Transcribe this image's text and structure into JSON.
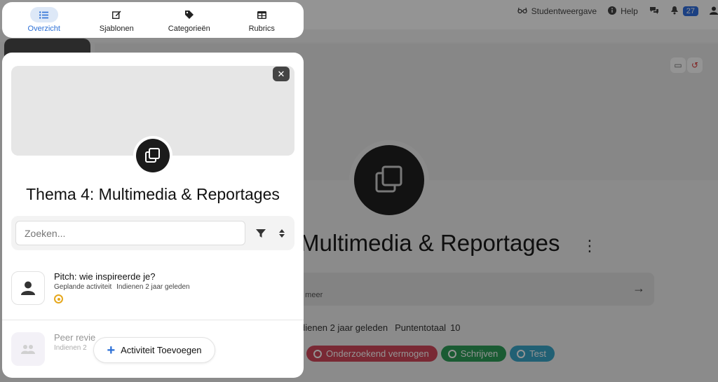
{
  "nav": {
    "items": [
      {
        "label": "Overzicht",
        "icon": "list-icon",
        "active": true
      },
      {
        "label": "Sjablonen",
        "icon": "edit-icon",
        "active": false
      },
      {
        "label": "Categorieën",
        "icon": "tag-icon",
        "active": false
      },
      {
        "label": "Rubrics",
        "icon": "table-icon",
        "active": false
      }
    ]
  },
  "topbar": {
    "student_view": "Studentweergave",
    "help": "Help",
    "notifications_count": "27"
  },
  "panel": {
    "title": "Thema 4: Multimedia & Reportages",
    "search_placeholder": "Zoeken...",
    "items": [
      {
        "title": "Pitch: wie inspireerde je?",
        "type": "Geplande activiteit",
        "due": "Indienen 2 jaar geleden"
      },
      {
        "title": "Peer revie",
        "due": "Indienen 2"
      }
    ],
    "add_button": "Activiteit Toevoegen"
  },
  "background": {
    "title": "Multimedia & Reportages",
    "desc_more": "n meer",
    "meta_due": "dienen  2 jaar geleden",
    "meta_points_label": "Puntentotaal",
    "meta_points_value": "10",
    "tags": [
      {
        "label": "Onderzoekend vermogen",
        "color": "#d1475a"
      },
      {
        "label": "Schrijven",
        "color": "#2e9e58"
      },
      {
        "label": "Test",
        "color": "#3aa6c8"
      }
    ]
  },
  "colors": {
    "accent": "#2b6fd6",
    "warning": "#e6a81e"
  }
}
